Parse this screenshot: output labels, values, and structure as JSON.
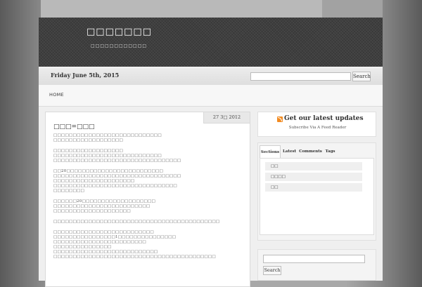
{
  "site": {
    "title": "□□□□□□□",
    "description": "□□□□□□□□□□□□"
  },
  "datebar": {
    "date": "Friday June 5th, 2015",
    "search_button": "Search"
  },
  "nav": {
    "items": [
      {
        "label": "HOME"
      }
    ]
  },
  "post": {
    "date": "27 3□ 2012",
    "title": "□□□=□□□",
    "paragraphs": [
      [
        "□□□□□□□□□□□□□□□□□□□□□□□□□□□□",
        "□□□□□□□□□□□□□□□□□□"
      ],
      [
        "□□□□□□□□□□□□□□□□□□",
        "□□□□□□□□□□□□□□□□□□□□□□□□□□□□",
        "□□□□□□□□□□□□□□□□□□□□□□□□□□□□□□□□□"
      ],
      [
        "□□20□□□□□□□□□□□□□□□□□□□□□□□□□",
        "□□□□□□□□□□□□□□□□□□□□□□□□□□□□□□□□□",
        "□□□□□□□□□□□□□□□□□□□□□",
        "□□□□□□□□□□□□□□□□□□□□□□□□□□□□□□□□",
        "□□□□□□□□"
      ],
      [
        "□□□□□□20□□□□□□□□□□□□□□□□□□□",
        "□□□□□□□□□□□□□□□□□□□□□□□□□",
        "□□□□□□□□□□□□□□□□□□□□"
      ],
      [
        "□□□□□□□□□□□□□□□□□□□□□□□□□□□□□□□□□□□□□□□□□□□"
      ],
      [
        "□□□□□□□□□□□□□□□□□□□□□□□□□□",
        "□□□□□□□□□□□□□□□□1□□□□□□□□□□□□□□□",
        "□□□□□□□□□□□□□□□□□□□□□□□□",
        "□□□□□□□□□□□□□□□",
        "□□□□□□□□□□□□□□□□□□□□□□□□□□□",
        "□□□□□□□□□□□□□□□□□□□□□□□□□□□□□□□□□□□□□□□□□□"
      ]
    ]
  },
  "sidebar": {
    "rss_title": "Get our latest updates",
    "rss_subtitle": "Subscribe Via A Feed Reader",
    "tabs": [
      {
        "label": "Sections",
        "active": true
      },
      {
        "label": "Latest",
        "active": false
      },
      {
        "label": "Comments",
        "active": false
      },
      {
        "label": "Tags",
        "active": false
      }
    ],
    "categories": [
      "□□",
      "□□□□",
      "□□"
    ],
    "search_button": "Search"
  }
}
